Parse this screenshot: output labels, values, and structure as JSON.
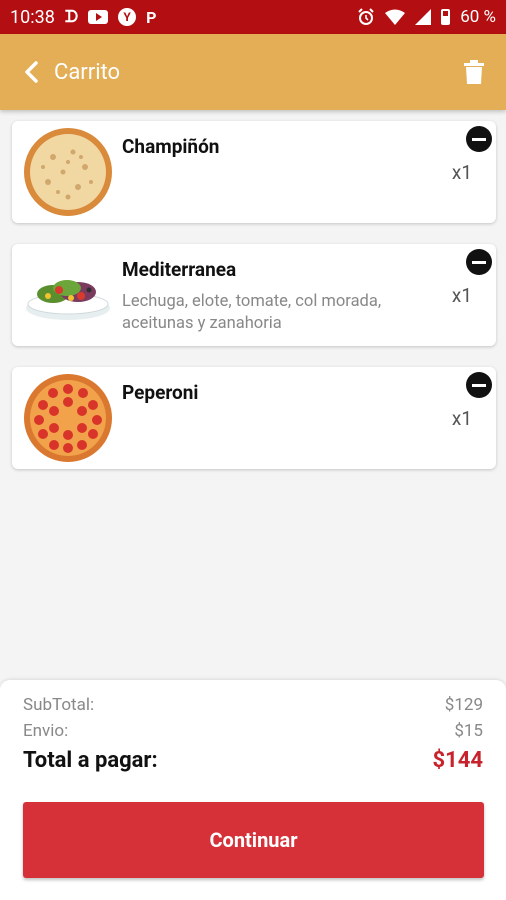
{
  "status_bar": {
    "time": "10:38",
    "battery": "60 %",
    "icons": [
      "d-app-icon",
      "youtube-icon",
      "y-circle-icon",
      "p-app-icon",
      "alarm-icon",
      "wifi-icon",
      "signal-icon",
      "battery-icon"
    ]
  },
  "header": {
    "title": "Carrito",
    "back_icon": "chevron-left-icon",
    "action_icon": "trash-icon"
  },
  "cart": {
    "items": [
      {
        "name": "Champiñón",
        "description": "",
        "quantity": "x1",
        "image": "mushroom-pizza"
      },
      {
        "name": "Mediterranea",
        "description": "Lechuga, elote, tomate, col morada, aceitunas y zanahoria",
        "quantity": "x1",
        "image": "salad-bowl"
      },
      {
        "name": "Peperoni",
        "description": "",
        "quantity": "x1",
        "image": "pepperoni-pizza"
      }
    ]
  },
  "summary": {
    "subtotal_label": "SubTotal:",
    "subtotal_value": "$129",
    "shipping_label": "Envio:",
    "shipping_value": "$15",
    "total_label": "Total a pagar:",
    "total_value": "$144",
    "continue_label": "Continuar"
  },
  "colors": {
    "status_bar": "#b30f12",
    "app_bar": "#e3ae55",
    "accent_red": "#d63038",
    "total_red": "#c8232c"
  }
}
